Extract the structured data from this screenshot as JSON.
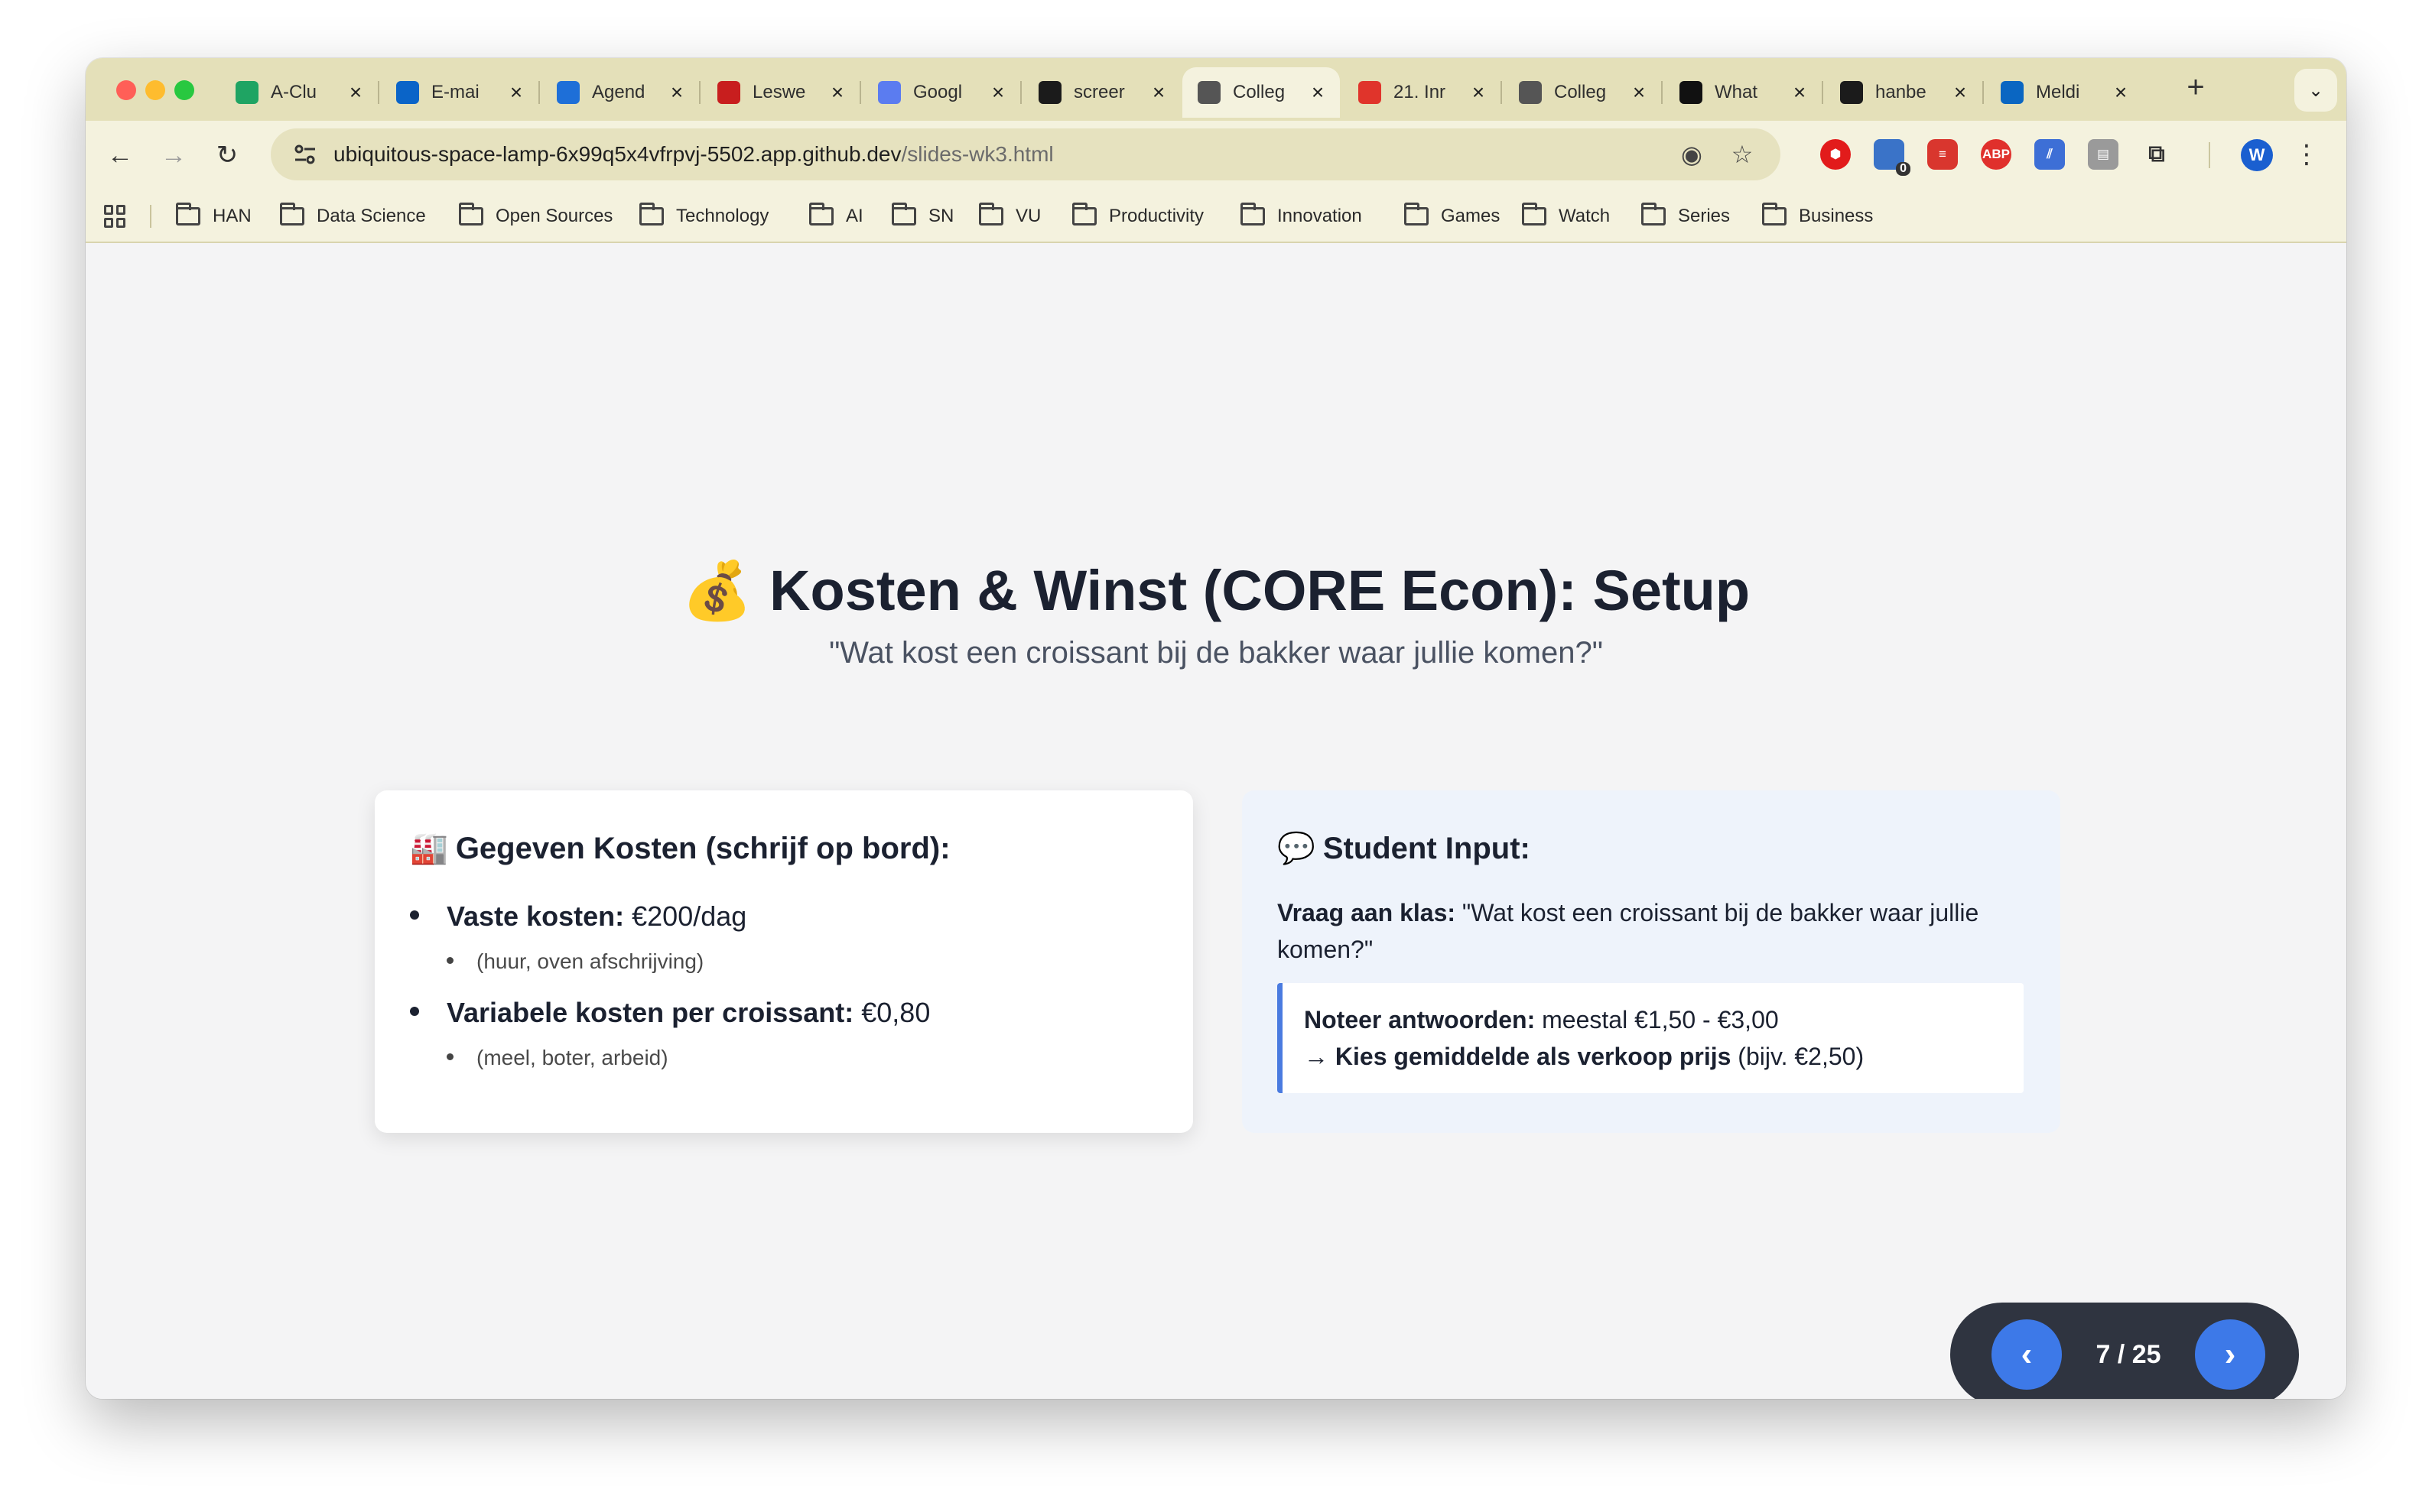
{
  "browser": {
    "tabs": [
      {
        "title": "A-Clu",
        "favicon": "google-drive-icon",
        "color": "#1fa463"
      },
      {
        "title": "E-mai",
        "favicon": "outlook-icon",
        "color": "#0a64c8"
      },
      {
        "title": "Agend",
        "favicon": "calendar-icon",
        "color": "#1e6fd8"
      },
      {
        "title": "Leswe",
        "favicon": "netflix-style-icon",
        "color": "#c81e1e"
      },
      {
        "title": "Googl",
        "favicon": "gemini-icon",
        "color": "#5b7cf0"
      },
      {
        "title": "screer",
        "favicon": "github-icon",
        "color": "#1b1b1b"
      },
      {
        "title": "Colleg",
        "favicon": "globe-icon",
        "color": "#555555",
        "active": true
      },
      {
        "title": "21. Inr",
        "favicon": "c-logo-icon",
        "color": "#e0342b"
      },
      {
        "title": "Colleg",
        "favicon": "globe-icon",
        "color": "#555555"
      },
      {
        "title": "What",
        "favicon": "openai-icon",
        "color": "#111111"
      },
      {
        "title": "hanbe",
        "favicon": "github-icon",
        "color": "#1b1b1b"
      },
      {
        "title": "Meldi",
        "favicon": "linkedin-icon",
        "color": "#0a66c2"
      }
    ],
    "new_tab": "+",
    "tab_menu": "⌄",
    "url_host": "ubiquitous-space-lamp-6x99q5x4vfrpvj-5502.app.github.dev",
    "url_path": "/slides-wk3.html",
    "avatar_initial": "W",
    "extension_badge": "0",
    "bookmarks": [
      "HAN",
      "Data Science",
      "Open Sources",
      "Technology",
      "AI",
      "SN",
      "VU",
      "Productivity",
      "Innovation",
      "Games",
      "Watch",
      "Series",
      "Business"
    ]
  },
  "slide": {
    "title_emoji": "💰",
    "title": "Kosten & Winst (CORE Econ): Setup",
    "subtitle": "\"Wat kost een croissant bij de bakker waar jullie komen?\"",
    "left_card": {
      "emoji": "🏭",
      "heading": "Gegeven Kosten (schrijf op bord):",
      "items": [
        {
          "label": "Vaste kosten:",
          "value": "€200/dag",
          "note": "(huur, oven afschrijving)"
        },
        {
          "label": "Variabele kosten per croissant:",
          "value": "€0,80",
          "note": "(meel, boter, arbeid)"
        }
      ]
    },
    "right_card": {
      "emoji": "💬",
      "heading": "Student Input:",
      "question_label": "Vraag aan klas:",
      "question_line1": "\"Wat kost een croissant bij de bakker waar jullie",
      "question_line2": "komen?\"",
      "answer_label": "Noteer antwoorden:",
      "answer_value": "meestal €1,50 - €3,00",
      "choose_label": "→ Kies gemiddelde als verkoop prijs",
      "choose_value": "(bijv. €2,50)"
    }
  },
  "pager": {
    "prev": "‹",
    "next": "›",
    "count": "7 / 25"
  },
  "colors": {
    "tabstrip": "#e4e0b9",
    "toolbar": "#f4f2de",
    "accent": "#3d79e8",
    "pager_bg": "#2f3440"
  }
}
